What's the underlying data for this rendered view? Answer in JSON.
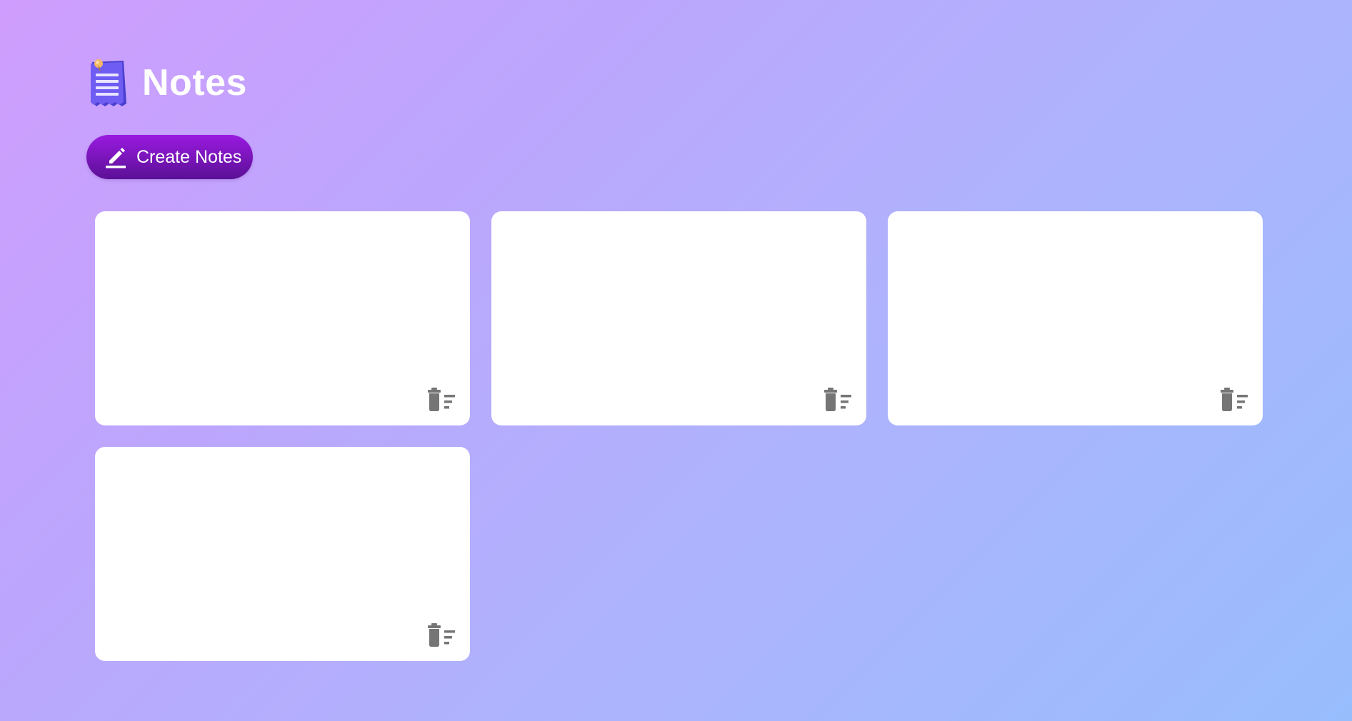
{
  "header": {
    "title": "Notes",
    "logo_icon": "notepad-icon"
  },
  "toolbar": {
    "create_label": "Create Notes",
    "create_icon": "pencil-icon"
  },
  "notes": [
    {
      "content": "",
      "delete_icon": "delete-sweep-icon"
    },
    {
      "content": "",
      "delete_icon": "delete-sweep-icon"
    },
    {
      "content": "",
      "delete_icon": "delete-sweep-icon"
    },
    {
      "content": "",
      "delete_icon": "delete-sweep-icon"
    }
  ],
  "colors": {
    "background_start": "#cf9dfd",
    "background_end": "#98bdfd",
    "button_top": "#9a1ae0",
    "button_bottom": "#5b1096",
    "card": "#ffffff",
    "delete_icon": "#757575"
  }
}
